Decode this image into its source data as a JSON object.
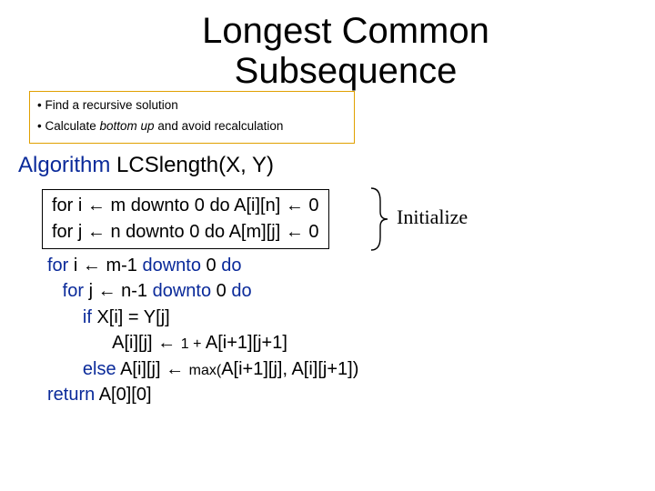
{
  "title_line1": "Longest Common",
  "title_line2": "Subsequence",
  "bullet1_prefix": "• Find a recursive solution",
  "bullet2_prefix": "• Calculate ",
  "bullet2_em": "bottom up",
  "bullet2_suffix": " and avoid recalculation",
  "algo_kw": "Algorithm",
  "algo_sig": " LCSlength(X, Y)",
  "init_line1_a": "for",
  "init_line1_b": " i ← m ",
  "init_line1_c": "downto",
  "init_line1_d": " 0 ",
  "init_line1_e": "do",
  "init_line1_f": " A[i][n] ← 0",
  "init_line2_a": "for",
  "init_line2_b": " j ← n ",
  "init_line2_c": "downto",
  "init_line2_d": " 0 ",
  "init_line2_e": "do",
  "init_line2_f": " A[m][j] ← 0",
  "init_label": "Initialize",
  "c1_a": "for",
  "c1_b": " i ← m-1 ",
  "c1_c": "downto",
  "c1_d": " 0 ",
  "c1_e": "do",
  "c2_a": "for",
  "c2_b": " j ← n-1 ",
  "c2_c": "downto",
  "c2_d": " 0 ",
  "c2_e": "do",
  "c3_a": "if",
  "c3_b": " X[i] = Y[j]",
  "c4_a": "A[i][j] ← ",
  "c4_b": "1 + ",
  "c4_c": "A[i+1][j+1]",
  "c5_a": "else",
  "c5_b": " A[i][j] ← ",
  "c5_c": "max(",
  "c5_d": "A[i+1][j], A[i][j+1])",
  "c6_a": "return",
  "c6_b": " A[0][0]"
}
